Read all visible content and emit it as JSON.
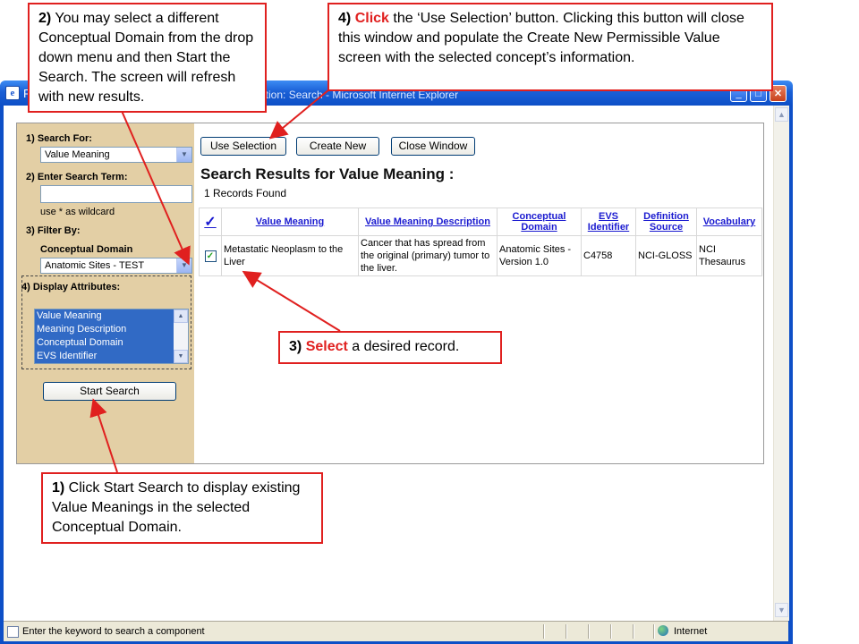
{
  "window": {
    "title_left": "F",
    "title_right": "ation: Search - Microsoft Internet Explorer",
    "status_text": "Enter the keyword to search a component",
    "zone_label": "Internet"
  },
  "left_panel": {
    "search_for_label": "1)  Search For:",
    "search_for_value": "Value Meaning",
    "search_term_label": "2)  Enter Search Term:",
    "search_term_value": "",
    "wildcard_note": "use * as wildcard",
    "filter_by_label": "3)  Filter By:",
    "conceptual_domain_label": "Conceptual Domain",
    "conceptual_domain_value": "Anatomic Sites - TEST",
    "display_attributes_label": "4)  Display Attributes:",
    "attributes": [
      "Value Meaning",
      "Meaning Description",
      "Conceptual Domain",
      "EVS Identifier"
    ],
    "start_search_label": "Start Search"
  },
  "toolbar": {
    "use_selection_label": "Use Selection",
    "create_new_label": "Create New",
    "close_window_label": "Close Window"
  },
  "results": {
    "title": "Search Results for Value Meaning :",
    "count_text": "1 Records Found",
    "header_check": "✓",
    "columns": [
      "Value Meaning",
      "Value Meaning Description",
      "Conceptual Domain",
      "EVS Identifier",
      "Definition Source",
      "Vocabulary"
    ],
    "rows": [
      {
        "checked": true,
        "value_meaning": "Metastatic Neoplasm to the Liver",
        "description": "Cancer that has spread from the original (primary) tumor to the liver.",
        "conceptual_domain": "Anatomic Sites - Version 1.0",
        "evs_identifier": "C4758",
        "definition_source": "NCI-GLOSS",
        "vocabulary": "NCI Thesaurus"
      }
    ]
  },
  "callouts": {
    "c2_num": "2)",
    "c2_text": " You may select a different Conceptual Domain from the drop down menu and then Start the Search. The screen will refresh with new results.",
    "c4_num": "4)",
    "c4_verb": "Click",
    "c4_text": " the ‘Use Selection’ button. Clicking this button will close this window and populate the Create New Permissible Value screen with the selected concept’s information.",
    "c3_num": "3)",
    "c3_verb": "Select",
    "c3_text": " a desired record.",
    "c1_num": "1)",
    "c1_text": " Click Start Search to display existing Value Meanings in the selected Conceptual Domain."
  },
  "colors": {
    "callout_border": "#e0201f",
    "panel_bg": "#e3cfa5",
    "link_blue": "#1a1ad0",
    "titlebar_blue": "#0d4fc7"
  }
}
